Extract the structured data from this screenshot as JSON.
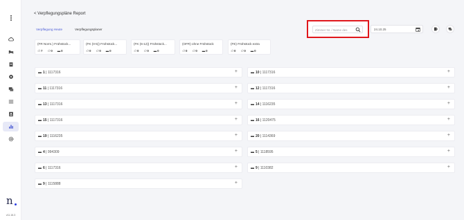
{
  "sidebar": {
    "version": "v11.16.3",
    "icons": [
      "cloud-icon",
      "bed-icon",
      "clipboard-icon",
      "eye-icon",
      "chat-icon",
      "list-icon",
      "contact-icon",
      "chart-icon",
      "gear-icon"
    ]
  },
  "header": {
    "back_label": "< Verpflegungspläne Report",
    "tabs": [
      {
        "label": "Verpflegung Heute"
      },
      {
        "label": "Verpflegungsplaner"
      }
    ],
    "search": {
      "placeholder": "Zimmer Nr. / Name des"
    },
    "date": "24.10.25"
  },
  "summary": [
    {
      "title": "(FR Norm.) Frühstück...",
      "stats": [
        "7",
        "0",
        "0"
      ]
    },
    {
      "title": "(FK (0-5)) Frühstück...",
      "stats": [
        "0",
        "0",
        "0"
      ]
    },
    {
      "title": "(FK (6-12)) Frühstück...",
      "stats": [
        "0",
        "0",
        "0"
      ]
    },
    {
      "title": "(OFR) ohne Frühstück",
      "stats": [
        "0",
        "0",
        "0"
      ]
    },
    {
      "title": "(FE) Frühstück extra",
      "stats": [
        "0",
        "0",
        "0"
      ]
    }
  ],
  "rooms_left": [
    {
      "number": "1",
      "id": "1117316"
    },
    {
      "number": "11",
      "id": "1117316"
    },
    {
      "number": "13",
      "id": "1117316"
    },
    {
      "number": "15",
      "id": "1117316"
    },
    {
      "number": "19",
      "id": "1116235"
    },
    {
      "number": "4",
      "id": "994309"
    },
    {
      "number": "6",
      "id": "1117316"
    },
    {
      "number": "9",
      "id": "1115888"
    }
  ],
  "rooms_right": [
    {
      "number": "10",
      "id": "1117316"
    },
    {
      "number": "12",
      "id": "1117316"
    },
    {
      "number": "14",
      "id": "1116235"
    },
    {
      "number": "16",
      "id": "1120475"
    },
    {
      "number": "20",
      "id": "1114369"
    },
    {
      "number": "5",
      "id": "1118595"
    },
    {
      "number": "9",
      "id": "1110382"
    }
  ],
  "colors": {
    "accent": "#4a5bd6",
    "highlight": "#e0161b"
  }
}
